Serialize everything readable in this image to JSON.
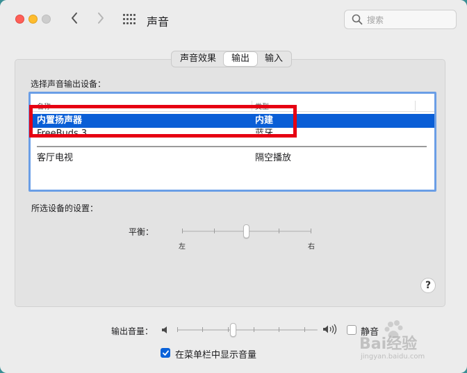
{
  "window": {
    "title": "声音",
    "nav": {
      "back_icon": "chevron-left-icon",
      "forward_icon": "chevron-right-icon",
      "grid_icon": "grid-icon"
    }
  },
  "search": {
    "placeholder": "搜索",
    "value": ""
  },
  "tabs": [
    {
      "label": "声音效果",
      "active": false
    },
    {
      "label": "输出",
      "active": true
    },
    {
      "label": "输入",
      "active": false
    }
  ],
  "output_devices": {
    "heading": "选择声音输出设备：",
    "columns": {
      "name": "名称",
      "type": "类型"
    },
    "rows": [
      {
        "name": "内置扬声器",
        "type": "内建",
        "selected": true
      },
      {
        "name": "FreeBuds 3",
        "type": "蓝牙",
        "selected": false
      },
      {
        "name": "客厅电视",
        "type": "隔空播放",
        "selected": false
      }
    ]
  },
  "selected_device_settings": {
    "heading": "所选设备的设置：",
    "balance": {
      "label": "平衡：",
      "left_label": "左",
      "right_label": "右",
      "value": 0.5
    }
  },
  "help_button": {
    "label": "?"
  },
  "output_volume": {
    "label": "输出音量：",
    "value": 0.4,
    "low_icon": "speaker-low-icon",
    "high_icon": "speaker-high-icon",
    "mute_label": "静音",
    "muted": false
  },
  "menubar_option": {
    "label": "在菜单栏中显示音量",
    "checked": true
  },
  "watermark": {
    "text": "Bai经验",
    "url_text": "jingyan.baidu.com"
  },
  "colors": {
    "selection": "#0a5ed6",
    "annotation_box": "#e60012",
    "checkbox_accent": "#0a62d9"
  }
}
